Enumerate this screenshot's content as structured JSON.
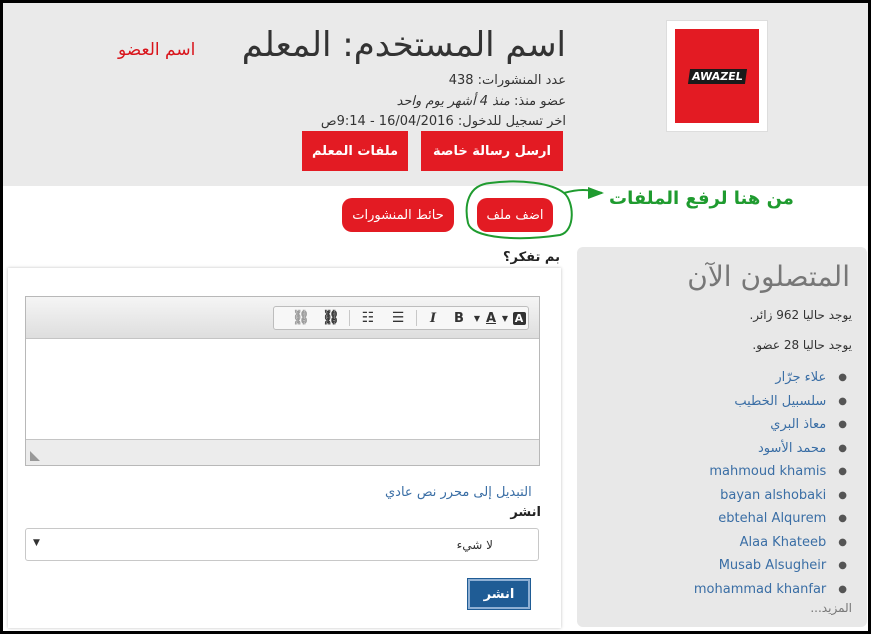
{
  "header": {
    "title": "اسم المستخدم: المعلم",
    "member_label": "اسم العضو",
    "logo_text": "AWAZEL",
    "posts_count": "عدد المنشورات: 438",
    "member_since_prefix": "عضو منذ:",
    "member_since_value": "منذ 4 أشهر يوم واحد",
    "last_login": "اخر تسجيل للدخول: 16/04/2016 - 9:14ص",
    "send_message_button": "ارسل رسالة خاصة",
    "teacher_files_button": "ملفات المعلم"
  },
  "actions": {
    "add_file_button": "اضف ملف",
    "wall_button": "حائط المنشورات",
    "annotation_text": "من هنا لرفع الملفات"
  },
  "online": {
    "title": "المتصلون الآن",
    "visitors": "يوجد حاليا 962 زائر.",
    "members": "يوجد حاليا 28 عضو.",
    "users": [
      "علاء جرّار",
      "سلسبيل الخطيب",
      "معاذ البري",
      "محمد الأسود",
      "mahmoud khamis",
      "bayan alshobaki",
      "ebtehal Alqurem",
      "Alaa Khateeb",
      "Musab Alsugheir",
      "mohammad khanfar"
    ],
    "more_link": "المزيد..."
  },
  "form": {
    "prompt_label": "بم تفكر؟",
    "switch_editor_link": "التبديل إلى محرر نص عادي",
    "publish_label": "انشر",
    "select_value": "لا شيء",
    "submit_button": "انشر",
    "toolbar": {
      "bold": "B",
      "italic": "I",
      "font_color": "A",
      "bg_color": "A"
    }
  },
  "colors": {
    "brand_red": "#e31b23",
    "annotation_green": "#1f9b2f",
    "link_blue": "#3a6ea5",
    "submit_blue": "#1f5c95"
  }
}
